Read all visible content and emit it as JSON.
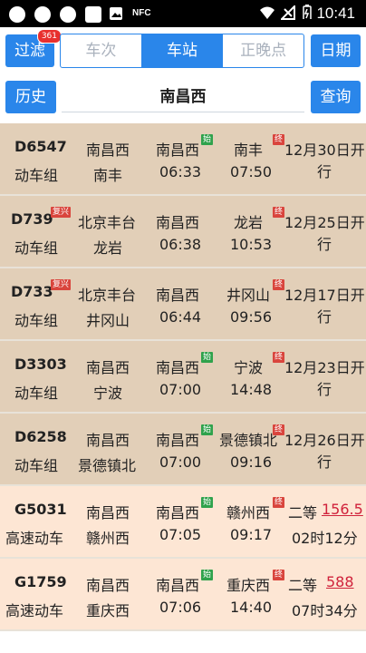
{
  "status_bar": {
    "time": "10:41",
    "carrier_label": "NFC"
  },
  "toolbar": {
    "filter_label": "过滤",
    "filter_badge": "361",
    "tabs": [
      "车次",
      "车站",
      "正晚点"
    ],
    "active_tab": "车站",
    "date_label": "日期",
    "history_label": "历史",
    "station_value": "南昌西",
    "query_label": "查询"
  },
  "colors": {
    "accent": "#2a86ea",
    "row_emu": "#e2cfb8",
    "row_hsr": "#fde6d4",
    "price": "#d0223b",
    "badge": "#e8302e"
  },
  "trains": [
    {
      "code": "D6547",
      "type": "动车组",
      "from": "南昌西",
      "to": "南丰",
      "stop": "南昌西",
      "dep": "06:33",
      "arr_station": "南丰",
      "arr": "07:50",
      "date": "12月30日开",
      "date2": "行",
      "stop_tag": "始",
      "end_tag": "终",
      "fx": ""
    },
    {
      "code": "D739",
      "type": "动车组",
      "from": "北京丰台",
      "to": "龙岩",
      "stop": "南昌西",
      "dep": "06:38",
      "arr_station": "龙岩",
      "arr": "10:53",
      "date": "12月25日开",
      "date2": "行",
      "stop_tag": "",
      "end_tag": "终",
      "fx": "复兴"
    },
    {
      "code": "D733",
      "type": "动车组",
      "from": "北京丰台",
      "to": "井冈山",
      "stop": "南昌西",
      "dep": "06:44",
      "arr_station": "井冈山",
      "arr": "09:56",
      "date": "12月17日开",
      "date2": "行",
      "stop_tag": "",
      "end_tag": "终",
      "fx": "复兴"
    },
    {
      "code": "D3303",
      "type": "动车组",
      "from": "南昌西",
      "to": "宁波",
      "stop": "南昌西",
      "dep": "07:00",
      "arr_station": "宁波",
      "arr": "14:48",
      "date": "12月23日开",
      "date2": "行",
      "stop_tag": "始",
      "end_tag": "终",
      "fx": ""
    },
    {
      "code": "D6258",
      "type": "动车组",
      "from": "南昌西",
      "to": "景德镇北",
      "stop": "南昌西",
      "dep": "07:00",
      "arr_station": "景德镇北",
      "arr": "09:16",
      "date": "12月26日开",
      "date2": "行",
      "stop_tag": "始",
      "end_tag": "终",
      "fx": ""
    },
    {
      "code": "G5031",
      "type": "高速动车",
      "from": "南昌西",
      "to": "赣州西",
      "stop": "南昌西",
      "dep": "07:05",
      "arr_station": "赣州西",
      "arr": "09:17",
      "seat": "二等",
      "price": "156.5",
      "duration": "02时12分",
      "stop_tag": "始",
      "end_tag": "终",
      "fx": ""
    },
    {
      "code": "G1759",
      "type": "高速动车",
      "from": "南昌西",
      "to": "重庆西",
      "stop": "南昌西",
      "dep": "07:06",
      "arr_station": "重庆西",
      "arr": "14:40",
      "seat": "二等",
      "price": "588",
      "duration": "07时34分",
      "stop_tag": "始",
      "end_tag": "终",
      "fx": ""
    }
  ]
}
